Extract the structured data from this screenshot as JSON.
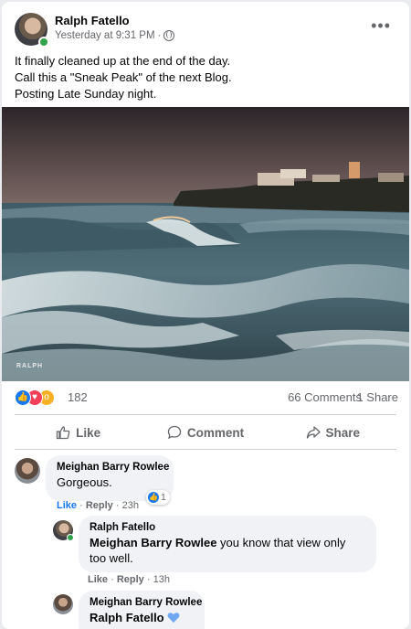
{
  "post": {
    "author": "Ralph Fatello",
    "timestamp": "Yesterday at 9:31 PM",
    "separator": "·",
    "lines": [
      "It finally cleaned up at the end of the day.",
      "Call this a \"Sneak Peak\" of the next Blog.",
      "Posting Late Sunday night."
    ],
    "photo_watermark": "RALPH"
  },
  "stats": {
    "reaction_count": "182",
    "comments": "66 Comments",
    "shares": "1 Share"
  },
  "actions": {
    "like": "Like",
    "comment": "Comment",
    "share": "Share"
  },
  "comments": [
    {
      "name": "Meighan Barry Rowlee",
      "text": "Gorgeous.",
      "like": "Like",
      "reply": "Reply",
      "time": "23h",
      "reaction_count": "1"
    },
    {
      "name": "Ralph Fatello",
      "mention": "Meighan Barry Rowlee",
      "text": " you know that view only",
      "text2": "too well.",
      "like": "Like",
      "reply": "Reply",
      "time": "13h"
    },
    {
      "name": "Meighan Barry Rowlee",
      "mention": "Ralph Fatello",
      "heart_color": "#6fa8f0"
    }
  ],
  "colors": {
    "accent": "#1877f2",
    "online": "#31a24c",
    "muted": "#65676b"
  }
}
